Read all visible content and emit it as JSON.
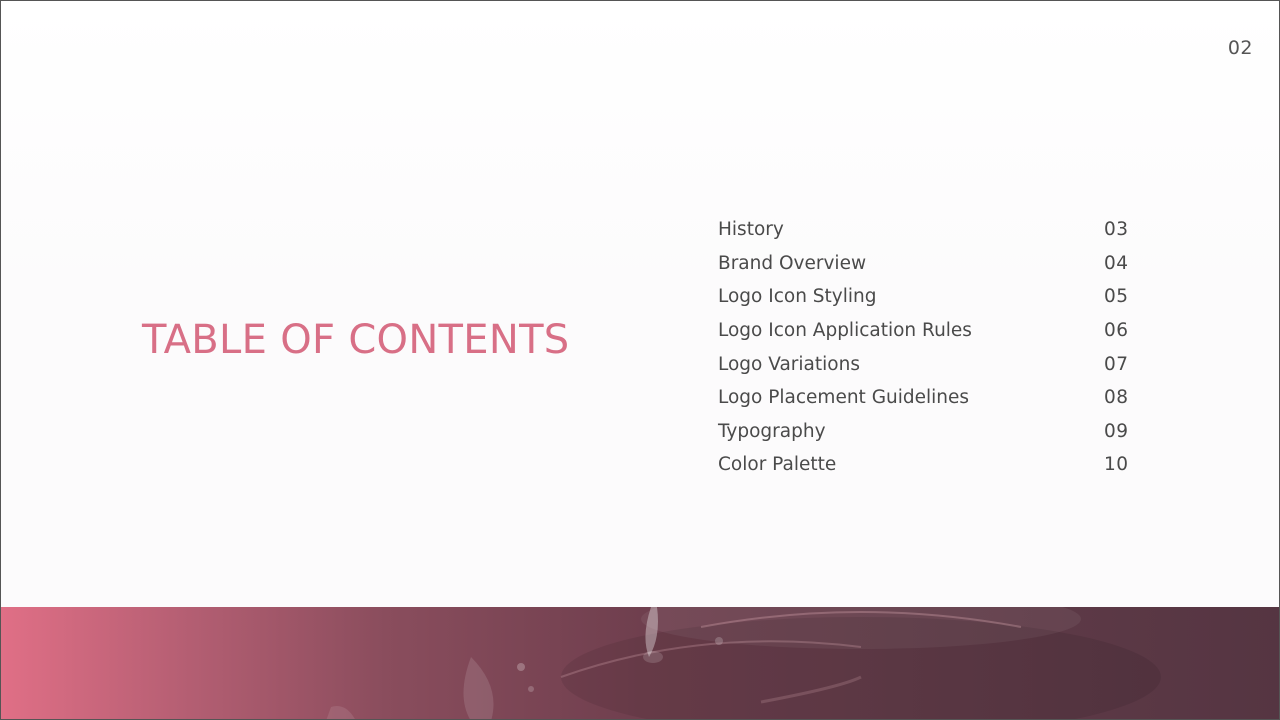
{
  "page_number": "02",
  "title": "TABLE OF CONTENTS",
  "toc": [
    {
      "label": "History",
      "page": "03"
    },
    {
      "label": "Brand Overview",
      "page": "04"
    },
    {
      "label": "Logo Icon Styling",
      "page": "05"
    },
    {
      "label": "Logo Icon Application Rules",
      "page": "06"
    },
    {
      "label": "Logo Variations",
      "page": "07"
    },
    {
      "label": "Logo Placement Guidelines",
      "page": "08"
    },
    {
      "label": "Typography",
      "page": "09"
    },
    {
      "label": "Color Palette",
      "page": "10"
    }
  ],
  "colors": {
    "title": "#d86f86",
    "text": "#4a4a4a",
    "band_start": "#e06f86",
    "band_end": "#553542"
  }
}
